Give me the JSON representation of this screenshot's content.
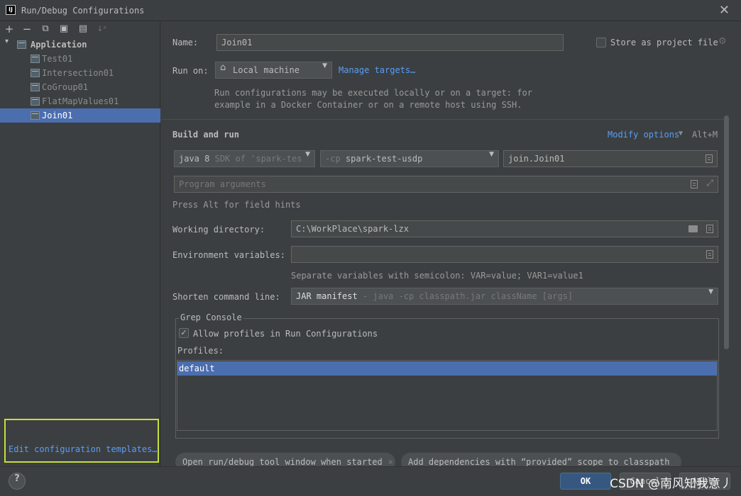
{
  "window": {
    "title": "Run/Debug Configurations",
    "close_glyph": "✕"
  },
  "toolbar": {
    "add": "+",
    "remove": "−",
    "copy": "⧉",
    "save": "▣",
    "folder": "▤",
    "sort": "↓ᵃ"
  },
  "tree": {
    "root": {
      "label": "Application",
      "arrow": "▾"
    },
    "children": [
      "Test01",
      "Intersection01",
      "CoGroup01",
      "FlatMapValues01",
      "Join01"
    ],
    "selected": "Join01"
  },
  "templates_link": "Edit configuration templates…",
  "form": {
    "name_label": "Name:",
    "name_value": "Join01",
    "store_label": "Store as project file",
    "store_checked": false,
    "run_on_label": "Run on:",
    "run_on_value": "Local machine",
    "manage_targets": "Manage targets…",
    "run_hint_1": "Run configurations may be executed locally or on a target: for",
    "run_hint_2": "example in a Docker Container or on a remote host using SSH.",
    "build_run_title": "Build and run",
    "modify_options": "Modify options",
    "modify_shortcut": "Alt+M",
    "jdk_main": "java 8",
    "jdk_dim": "SDK of 'spark-tes",
    "cp_dim": "-cp",
    "cp_value": "spark-test-usdp",
    "main_class": "join.Join01",
    "program_args_placeholder": "Program arguments",
    "alt_hint": "Press Alt for field hints",
    "workdir_label": "Working directory:",
    "workdir_value": "C:\\WorkPlace\\spark-lzx",
    "env_label": "Environment variables:",
    "env_value": "",
    "env_hint": "Separate variables with semicolon: VAR=value; VAR1=value1",
    "shorten_label": "Shorten command line:",
    "shorten_main": "JAR manifest",
    "shorten_dim": "- java -cp classpath.jar className [args]"
  },
  "grep_console": {
    "title": "Grep Console",
    "allow_label": "Allow profiles in Run Configurations",
    "allow_checked": true,
    "profiles_label": "Profiles:",
    "profiles": [
      "default"
    ]
  },
  "chips": [
    {
      "label": "Open run/debug tool window when started"
    },
    {
      "label": "Add dependencies with “provided” scope to classpath"
    }
  ],
  "footer": {
    "help": "?",
    "ok": "OK",
    "cancel": "Cancel",
    "apply": "Apply",
    "watermark": "CSDN @南风知我意丿"
  }
}
